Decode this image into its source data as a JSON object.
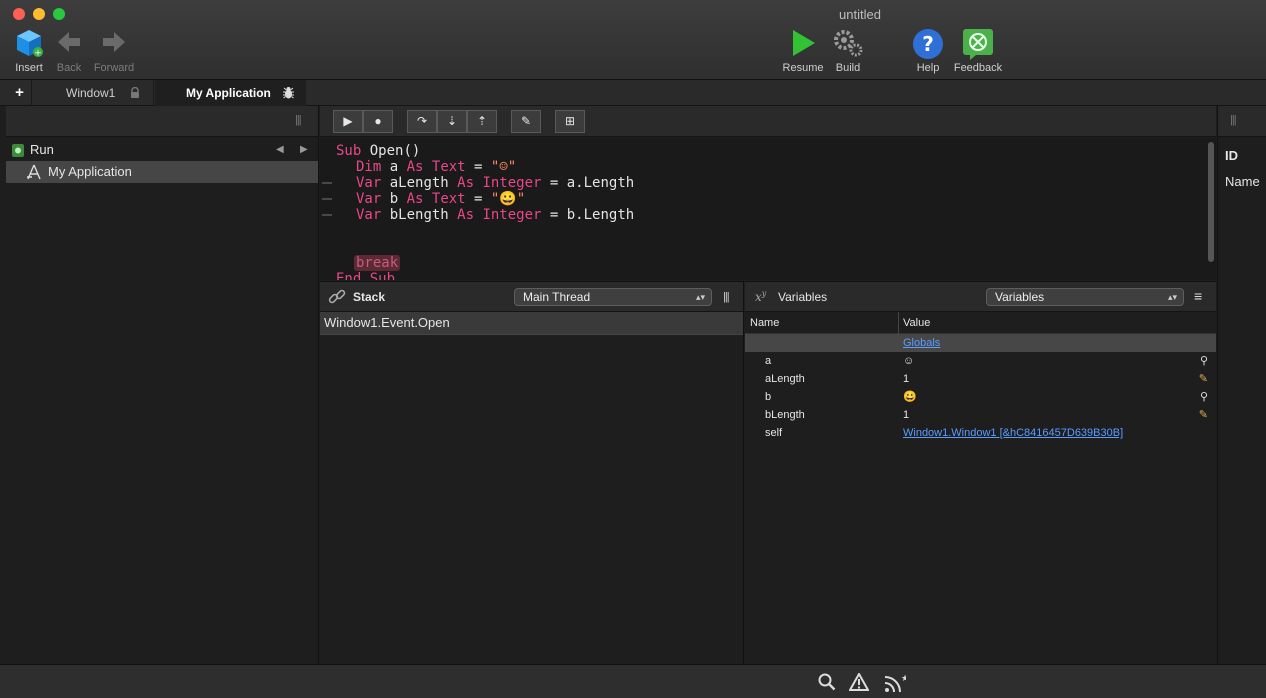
{
  "window": {
    "title": "untitled"
  },
  "toolbar": {
    "insert": "Insert",
    "back": "Back",
    "forward": "Forward",
    "resume": "Resume",
    "build": "Build",
    "help": "Help",
    "feedback": "Feedback"
  },
  "tabs": {
    "add": "+",
    "items": [
      {
        "label": "Window1"
      },
      {
        "label": "My Application"
      }
    ]
  },
  "navigator": {
    "run_label": "Run",
    "items": [
      {
        "label": "My Application"
      }
    ]
  },
  "code": {
    "lines": [
      "Sub Open()",
      "Dim a As Text = \"☺\"",
      "Var aLength As Integer = a.Length",
      "Var b As Text = \"😀\"",
      "Var bLength As Integer = b.Length",
      "break",
      "End Sub"
    ]
  },
  "stack": {
    "title": "Stack",
    "thread": "Main Thread",
    "frames": [
      "Window1.Event.Open"
    ]
  },
  "variables": {
    "title": "Variables",
    "scope": "Variables",
    "col_name": "Name",
    "col_value": "Value",
    "globals": "Globals",
    "rows": [
      {
        "name": "a",
        "value": "☺"
      },
      {
        "name": "aLength",
        "value": "1"
      },
      {
        "name": "b",
        "value": "😀"
      },
      {
        "name": "bLength",
        "value": "1"
      },
      {
        "name": "self",
        "value": "Window1.Window1 [&hC8416457D639B30B]"
      }
    ]
  },
  "inspector": {
    "id_label": "ID",
    "name_label": "Name"
  },
  "colors": {
    "keyword": "#e8478a",
    "string": "#ff8a5c",
    "link": "#5b9dff"
  }
}
